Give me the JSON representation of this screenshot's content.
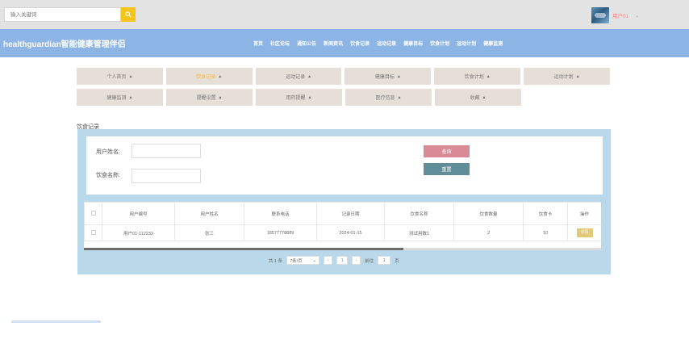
{
  "topbar": {
    "search_placeholder": "输入关键词",
    "user_name": "用户01",
    "caret": "⌄"
  },
  "header": {
    "title": "healthguardian智能健康管理伴侣",
    "nav": [
      "首页",
      "社区论坛",
      "通知公告",
      "新闻资讯",
      "饮食记录",
      "运动记录",
      "健康目标",
      "饮食计划",
      "运动计划",
      "健康监测"
    ]
  },
  "submenu": {
    "row1": [
      {
        "label": "个人首页",
        "active": false
      },
      {
        "label": "饮食记录",
        "active": true
      },
      {
        "label": "运动记录",
        "active": false
      },
      {
        "label": "健康目标",
        "active": false
      },
      {
        "label": "饮食计划",
        "active": false
      },
      {
        "label": "运动计划",
        "active": false
      }
    ],
    "row2": [
      {
        "label": "健康监测",
        "active": false
      },
      {
        "label": "提醒设置",
        "active": false
      },
      {
        "label": "用药提醒",
        "active": false
      },
      {
        "label": "医疗信息",
        "active": false
      },
      {
        "label": "收藏",
        "active": false
      }
    ]
  },
  "section_title": "饮食记录",
  "filter": {
    "username_label": "用户姓名:",
    "food_label": "饮食名称:",
    "query_label": "查询",
    "reset_label": "重置"
  },
  "table": {
    "headers": [
      "用户编号",
      "用户姓名",
      "联系电话",
      "记录日期",
      "饮食名称",
      "饮食数量",
      "饮食卡",
      "操作"
    ],
    "rows": [
      [
        "用户01-112233",
        "张三",
        "18577778889",
        "2024-01-15",
        "测试用数1",
        "2",
        "10",
        "详情"
      ]
    ]
  },
  "pager": {
    "total": "共 1 条",
    "page_size": "7条/页",
    "current_page": "1",
    "goto_label": "前往",
    "goto_value": "1",
    "page_suffix": "页"
  },
  "colors": {
    "header_bg": "#8cb4e4",
    "active_menu": "#f2b843",
    "query_btn": "#d98a94",
    "reset_btn": "#5f8e98",
    "panel_bg": "#b9d8ea"
  }
}
